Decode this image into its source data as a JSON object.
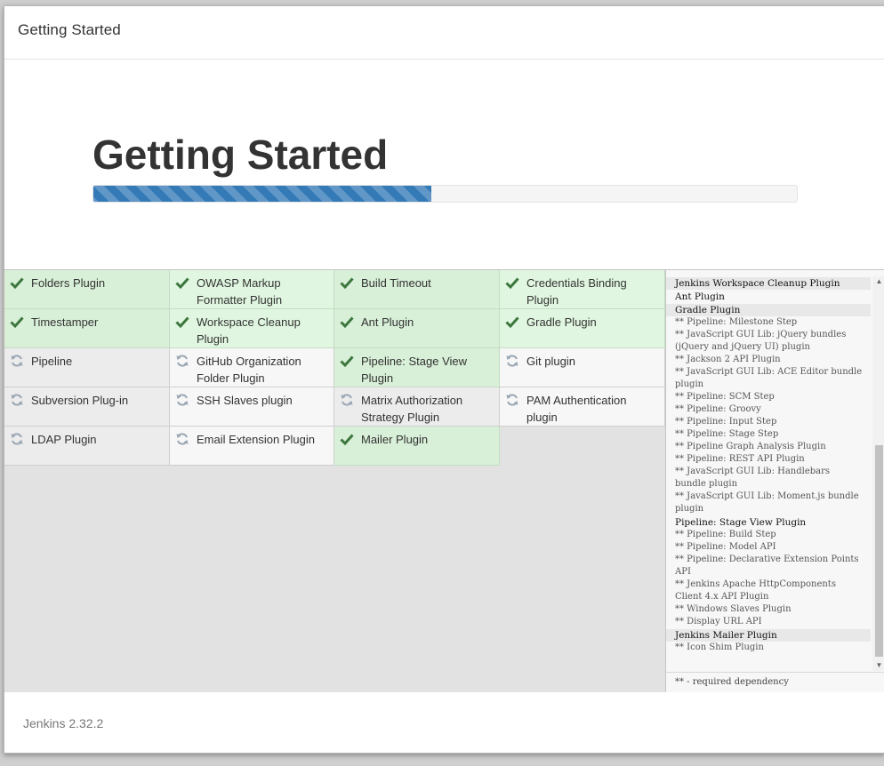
{
  "header": {
    "title": "Getting Started"
  },
  "hero": {
    "heading": "Getting Started",
    "progress": 0.48
  },
  "colors": {
    "success": "#3c763d",
    "pending": "#9aa6b3",
    "progress": "#337ab7"
  },
  "plugins": [
    {
      "name": "Folders Plugin",
      "status": "success",
      "icon": "check-icon"
    },
    {
      "name": "OWASP Markup Formatter Plugin",
      "status": "success",
      "icon": "check-icon"
    },
    {
      "name": "Build Timeout",
      "status": "success",
      "icon": "check-icon"
    },
    {
      "name": "Credentials Binding Plugin",
      "status": "success",
      "icon": "check-icon"
    },
    {
      "name": "Timestamper",
      "status": "success",
      "icon": "check-icon"
    },
    {
      "name": "Workspace Cleanup Plugin",
      "status": "success",
      "icon": "check-icon"
    },
    {
      "name": "Ant Plugin",
      "status": "success",
      "icon": "check-icon"
    },
    {
      "name": "Gradle Plugin",
      "status": "success",
      "icon": "check-icon"
    },
    {
      "name": "Pipeline",
      "status": "pending",
      "icon": "refresh-icon"
    },
    {
      "name": "GitHub Organization Folder Plugin",
      "status": "pending",
      "icon": "refresh-icon"
    },
    {
      "name": "Pipeline: Stage View Plugin",
      "status": "success",
      "icon": "check-icon"
    },
    {
      "name": "Git plugin",
      "status": "pending",
      "icon": "refresh-icon"
    },
    {
      "name": "Subversion Plug-in",
      "status": "pending",
      "icon": "refresh-icon"
    },
    {
      "name": "SSH Slaves plugin",
      "status": "pending",
      "icon": "refresh-icon"
    },
    {
      "name": "Matrix Authorization Strategy Plugin",
      "status": "pending",
      "icon": "refresh-icon"
    },
    {
      "name": "PAM Authentication plugin",
      "status": "pending",
      "icon": "refresh-icon"
    },
    {
      "name": "LDAP Plugin",
      "status": "pending",
      "icon": "refresh-icon"
    },
    {
      "name": "Email Extension Plugin",
      "status": "pending",
      "icon": "refresh-icon"
    },
    {
      "name": "Mailer Plugin",
      "status": "success",
      "icon": "check-icon"
    }
  ],
  "log": {
    "lines": [
      {
        "text": "Jenkins Workspace Cleanup Plugin",
        "type": "top",
        "hl": true
      },
      {
        "text": "Ant Plugin",
        "type": "top",
        "hl": false
      },
      {
        "text": "Gradle Plugin",
        "type": "top",
        "hl": true
      },
      {
        "text": "** Pipeline: Milestone Step",
        "type": "dep",
        "hl": false
      },
      {
        "text": "** JavaScript GUI Lib: jQuery bundles (jQuery and jQuery UI) plugin",
        "type": "dep",
        "hl": false
      },
      {
        "text": "** Jackson 2 API Plugin",
        "type": "dep",
        "hl": false
      },
      {
        "text": "** JavaScript GUI Lib: ACE Editor bundle plugin",
        "type": "dep",
        "hl": false
      },
      {
        "text": "** Pipeline: SCM Step",
        "type": "dep",
        "hl": false
      },
      {
        "text": "** Pipeline: Groovy",
        "type": "dep",
        "hl": false
      },
      {
        "text": "** Pipeline: Input Step",
        "type": "dep",
        "hl": false
      },
      {
        "text": "** Pipeline: Stage Step",
        "type": "dep",
        "hl": false
      },
      {
        "text": "** Pipeline Graph Analysis Plugin",
        "type": "dep",
        "hl": false
      },
      {
        "text": "** Pipeline: REST API Plugin",
        "type": "dep",
        "hl": false
      },
      {
        "text": "** JavaScript GUI Lib: Handlebars bundle plugin",
        "type": "dep",
        "hl": false
      },
      {
        "text": "** JavaScript GUI Lib: Moment.js bundle plugin",
        "type": "dep",
        "hl": false
      },
      {
        "text": "Pipeline: Stage View Plugin",
        "type": "top",
        "hl": false
      },
      {
        "text": "** Pipeline: Build Step",
        "type": "dep",
        "hl": false
      },
      {
        "text": "** Pipeline: Model API",
        "type": "dep",
        "hl": false
      },
      {
        "text": "** Pipeline: Declarative Extension Points API",
        "type": "dep",
        "hl": false
      },
      {
        "text": "** Jenkins Apache HttpComponents Client 4.x API Plugin",
        "type": "dep",
        "hl": false
      },
      {
        "text": "** Windows Slaves Plugin",
        "type": "dep",
        "hl": false
      },
      {
        "text": "** Display URL API",
        "type": "dep",
        "hl": false
      },
      {
        "text": "Jenkins Mailer Plugin",
        "type": "top",
        "hl": true
      },
      {
        "text": "** Icon Shim Plugin",
        "type": "dep",
        "hl": false
      }
    ],
    "footer": "** - required dependency"
  },
  "footer": {
    "version": "Jenkins 2.32.2"
  }
}
